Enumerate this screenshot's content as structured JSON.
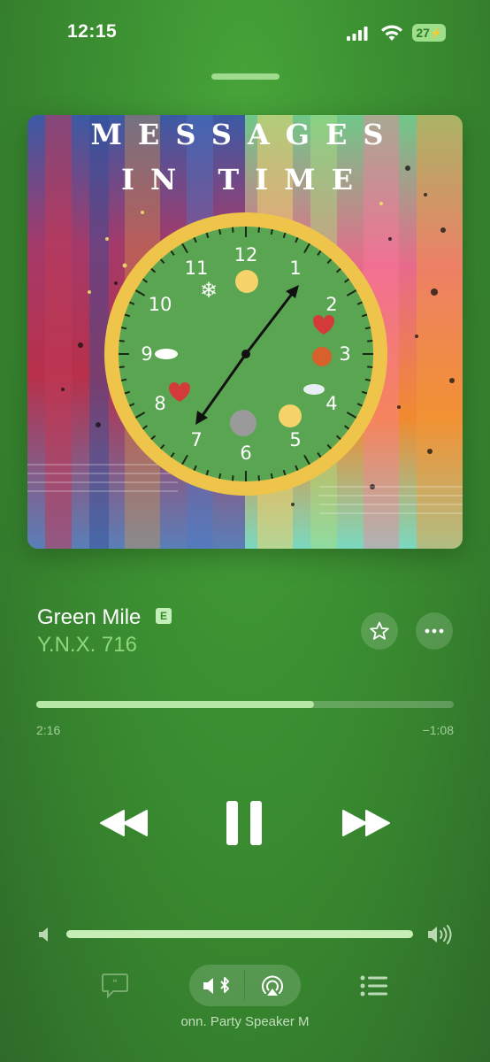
{
  "status_bar": {
    "time": "12:15",
    "battery": "27"
  },
  "album": {
    "title_line1": "MESSAGES",
    "title_line2": "IN TIME",
    "clock_numbers": [
      "12",
      "1",
      "2",
      "3",
      "4",
      "5",
      "6",
      "7",
      "8",
      "9",
      "10",
      "11"
    ]
  },
  "track": {
    "title": "Green Mile",
    "explicit": "E",
    "artist": "Y.N.X. 716"
  },
  "playback": {
    "elapsed": "2:16",
    "remaining": "−1:08",
    "progress_fraction": 0.666,
    "state": "playing"
  },
  "volume": {
    "level_fraction": 1.0
  },
  "output": {
    "device": "onn. Party Speaker M"
  },
  "icons": {
    "signal": "signal-bars-icon",
    "wifi": "wifi-icon",
    "battery": "battery-charging-icon",
    "star": "star-icon",
    "more": "ellipsis-icon",
    "rewind": "rewind-icon",
    "pause": "pause-icon",
    "forward": "fast-forward-icon",
    "volume_low": "speaker-low-icon",
    "volume_high": "speaker-high-icon",
    "lyrics": "lyrics-quote-icon",
    "bluetooth_speaker": "bluetooth-speaker-icon",
    "airplay": "airplay-icon",
    "queue": "queue-list-icon"
  },
  "colors": {
    "background": "#3d9332",
    "accent": "#8fd77a",
    "clock_face": "#5aa552",
    "clock_rim": "#eec44a"
  }
}
